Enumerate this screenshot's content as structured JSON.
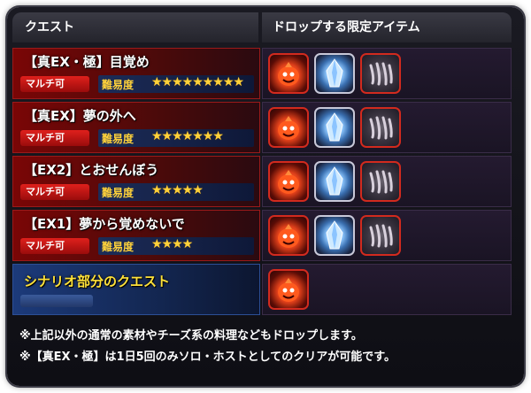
{
  "header": {
    "quest_col": "クエスト",
    "drop_col": "ドロップする限定アイテム"
  },
  "rows": [
    {
      "title": "【真EX・極】目覚め",
      "tag": "マルチ可",
      "difficulty_label": "難易度",
      "stars": "★★★★★★★★★",
      "star_count": 9,
      "items": [
        "red-blob-item",
        "blue-crystal-item",
        "claw-item"
      ]
    },
    {
      "title": "【真EX】夢の外へ",
      "tag": "マルチ可",
      "difficulty_label": "難易度",
      "stars": "★★★★★★★",
      "star_count": 7,
      "items": [
        "red-blob-item",
        "blue-crystal-item",
        "claw-item"
      ]
    },
    {
      "title": "【EX2】とおせんぼう",
      "tag": "マルチ可",
      "difficulty_label": "難易度",
      "stars": "★★★★★",
      "star_count": 5,
      "items": [
        "red-blob-item",
        "blue-crystal-item",
        "claw-item"
      ]
    },
    {
      "title": "【EX1】夢から覚めないで",
      "tag": "マルチ可",
      "difficulty_label": "難易度",
      "stars": "★★★★",
      "star_count": 4,
      "items": [
        "red-blob-item",
        "blue-crystal-item",
        "claw-item"
      ]
    },
    {
      "title": "シナリオ部分のクエスト",
      "items": [
        "red-blob-item"
      ]
    }
  ],
  "notes": [
    "※上記以外の通常の素材やチーズ系の料理などもドロップします。",
    "※【真EX・極】は1日5回のみソロ・ホストとしてのクリアが可能です。"
  ],
  "colors": {
    "quest_red": "#7a0606",
    "scenario_blue": "#1c3a7a",
    "star": "#ffd23a",
    "tag_red": "#e0201c"
  }
}
